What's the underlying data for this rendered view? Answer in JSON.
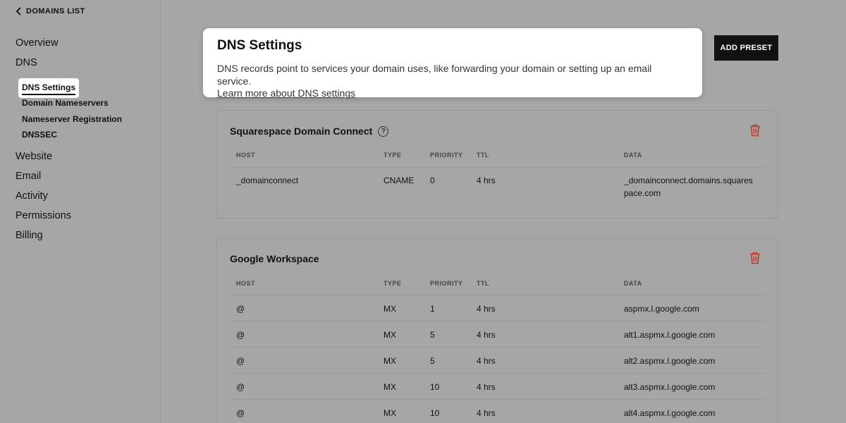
{
  "sidebar": {
    "back_label": "DOMAINS LIST",
    "main_items": [
      {
        "label": "Overview"
      },
      {
        "label": "DNS"
      },
      {
        "label": "Website"
      },
      {
        "label": "Email"
      },
      {
        "label": "Activity"
      },
      {
        "label": "Permissions"
      },
      {
        "label": "Billing"
      }
    ],
    "dns_sub_items": [
      {
        "label": "DNS Settings"
      },
      {
        "label": "Domain Nameservers"
      },
      {
        "label": "Nameserver Registration"
      },
      {
        "label": "DNSSEC"
      }
    ]
  },
  "popover": {
    "title": "DNS Settings",
    "description": "DNS records point to services your domain uses, like forwarding your domain or setting up an email service.",
    "link": "Learn more about DNS settings"
  },
  "toolbar": {
    "add_preset_label": "ADD PRESET"
  },
  "columns": [
    "HOST",
    "TYPE",
    "PRIORITY",
    "TTL",
    "DATA"
  ],
  "panels": [
    {
      "title": "Squarespace Domain Connect",
      "rows": [
        {
          "host": "_domainconnect",
          "type": "CNAME",
          "priority": "0",
          "ttl": "4 hrs",
          "data_line1": "_domainconnect.domains.squares",
          "data_line2": "pace.com"
        }
      ]
    },
    {
      "title": "Google Workspace",
      "rows": [
        {
          "host": "@",
          "type": "MX",
          "priority": "1",
          "ttl": "4 hrs",
          "data": "aspmx.l.google.com"
        },
        {
          "host": "@",
          "type": "MX",
          "priority": "5",
          "ttl": "4 hrs",
          "data": "alt1.aspmx.l.google.com"
        },
        {
          "host": "@",
          "type": "MX",
          "priority": "5",
          "ttl": "4 hrs",
          "data": "alt2.aspmx.l.google.com"
        },
        {
          "host": "@",
          "type": "MX",
          "priority": "10",
          "ttl": "4 hrs",
          "data": "alt3.aspmx.l.google.com"
        },
        {
          "host": "@",
          "type": "MX",
          "priority": "10",
          "ttl": "4 hrs",
          "data": "alt4.aspmx.l.google.com"
        }
      ]
    }
  ],
  "colors": {
    "overlay": "#a6a6a6",
    "trash": "#c0392b",
    "button_bg": "#111111"
  },
  "icons": {
    "back": "chevron-left-icon",
    "help": "question-circle-icon",
    "delete": "trash-icon"
  }
}
